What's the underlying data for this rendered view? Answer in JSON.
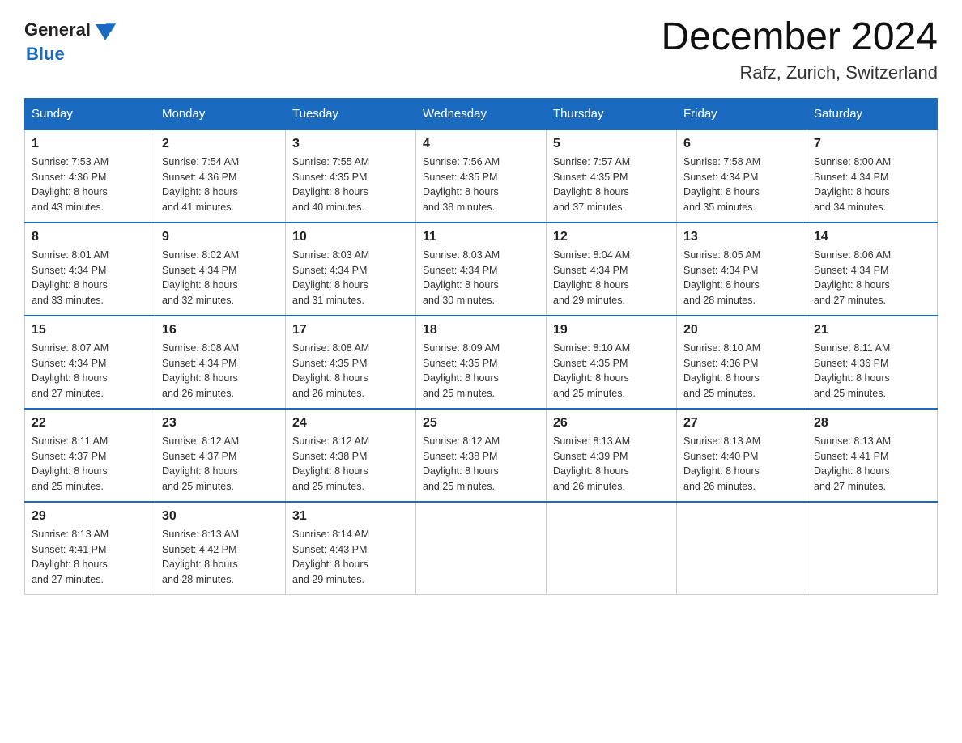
{
  "logo": {
    "text_general": "General",
    "text_blue": "Blue"
  },
  "title": "December 2024",
  "location": "Rafz, Zurich, Switzerland",
  "days_of_week": [
    "Sunday",
    "Monday",
    "Tuesday",
    "Wednesday",
    "Thursday",
    "Friday",
    "Saturday"
  ],
  "weeks": [
    [
      {
        "day": "1",
        "sunrise": "7:53 AM",
        "sunset": "4:36 PM",
        "daylight": "8 hours and 43 minutes."
      },
      {
        "day": "2",
        "sunrise": "7:54 AM",
        "sunset": "4:36 PM",
        "daylight": "8 hours and 41 minutes."
      },
      {
        "day": "3",
        "sunrise": "7:55 AM",
        "sunset": "4:35 PM",
        "daylight": "8 hours and 40 minutes."
      },
      {
        "day": "4",
        "sunrise": "7:56 AM",
        "sunset": "4:35 PM",
        "daylight": "8 hours and 38 minutes."
      },
      {
        "day": "5",
        "sunrise": "7:57 AM",
        "sunset": "4:35 PM",
        "daylight": "8 hours and 37 minutes."
      },
      {
        "day": "6",
        "sunrise": "7:58 AM",
        "sunset": "4:34 PM",
        "daylight": "8 hours and 35 minutes."
      },
      {
        "day": "7",
        "sunrise": "8:00 AM",
        "sunset": "4:34 PM",
        "daylight": "8 hours and 34 minutes."
      }
    ],
    [
      {
        "day": "8",
        "sunrise": "8:01 AM",
        "sunset": "4:34 PM",
        "daylight": "8 hours and 33 minutes."
      },
      {
        "day": "9",
        "sunrise": "8:02 AM",
        "sunset": "4:34 PM",
        "daylight": "8 hours and 32 minutes."
      },
      {
        "day": "10",
        "sunrise": "8:03 AM",
        "sunset": "4:34 PM",
        "daylight": "8 hours and 31 minutes."
      },
      {
        "day": "11",
        "sunrise": "8:03 AM",
        "sunset": "4:34 PM",
        "daylight": "8 hours and 30 minutes."
      },
      {
        "day": "12",
        "sunrise": "8:04 AM",
        "sunset": "4:34 PM",
        "daylight": "8 hours and 29 minutes."
      },
      {
        "day": "13",
        "sunrise": "8:05 AM",
        "sunset": "4:34 PM",
        "daylight": "8 hours and 28 minutes."
      },
      {
        "day": "14",
        "sunrise": "8:06 AM",
        "sunset": "4:34 PM",
        "daylight": "8 hours and 27 minutes."
      }
    ],
    [
      {
        "day": "15",
        "sunrise": "8:07 AM",
        "sunset": "4:34 PM",
        "daylight": "8 hours and 27 minutes."
      },
      {
        "day": "16",
        "sunrise": "8:08 AM",
        "sunset": "4:34 PM",
        "daylight": "8 hours and 26 minutes."
      },
      {
        "day": "17",
        "sunrise": "8:08 AM",
        "sunset": "4:35 PM",
        "daylight": "8 hours and 26 minutes."
      },
      {
        "day": "18",
        "sunrise": "8:09 AM",
        "sunset": "4:35 PM",
        "daylight": "8 hours and 25 minutes."
      },
      {
        "day": "19",
        "sunrise": "8:10 AM",
        "sunset": "4:35 PM",
        "daylight": "8 hours and 25 minutes."
      },
      {
        "day": "20",
        "sunrise": "8:10 AM",
        "sunset": "4:36 PM",
        "daylight": "8 hours and 25 minutes."
      },
      {
        "day": "21",
        "sunrise": "8:11 AM",
        "sunset": "4:36 PM",
        "daylight": "8 hours and 25 minutes."
      }
    ],
    [
      {
        "day": "22",
        "sunrise": "8:11 AM",
        "sunset": "4:37 PM",
        "daylight": "8 hours and 25 minutes."
      },
      {
        "day": "23",
        "sunrise": "8:12 AM",
        "sunset": "4:37 PM",
        "daylight": "8 hours and 25 minutes."
      },
      {
        "day": "24",
        "sunrise": "8:12 AM",
        "sunset": "4:38 PM",
        "daylight": "8 hours and 25 minutes."
      },
      {
        "day": "25",
        "sunrise": "8:12 AM",
        "sunset": "4:38 PM",
        "daylight": "8 hours and 25 minutes."
      },
      {
        "day": "26",
        "sunrise": "8:13 AM",
        "sunset": "4:39 PM",
        "daylight": "8 hours and 26 minutes."
      },
      {
        "day": "27",
        "sunrise": "8:13 AM",
        "sunset": "4:40 PM",
        "daylight": "8 hours and 26 minutes."
      },
      {
        "day": "28",
        "sunrise": "8:13 AM",
        "sunset": "4:41 PM",
        "daylight": "8 hours and 27 minutes."
      }
    ],
    [
      {
        "day": "29",
        "sunrise": "8:13 AM",
        "sunset": "4:41 PM",
        "daylight": "8 hours and 27 minutes."
      },
      {
        "day": "30",
        "sunrise": "8:13 AM",
        "sunset": "4:42 PM",
        "daylight": "8 hours and 28 minutes."
      },
      {
        "day": "31",
        "sunrise": "8:14 AM",
        "sunset": "4:43 PM",
        "daylight": "8 hours and 29 minutes."
      },
      null,
      null,
      null,
      null
    ]
  ]
}
